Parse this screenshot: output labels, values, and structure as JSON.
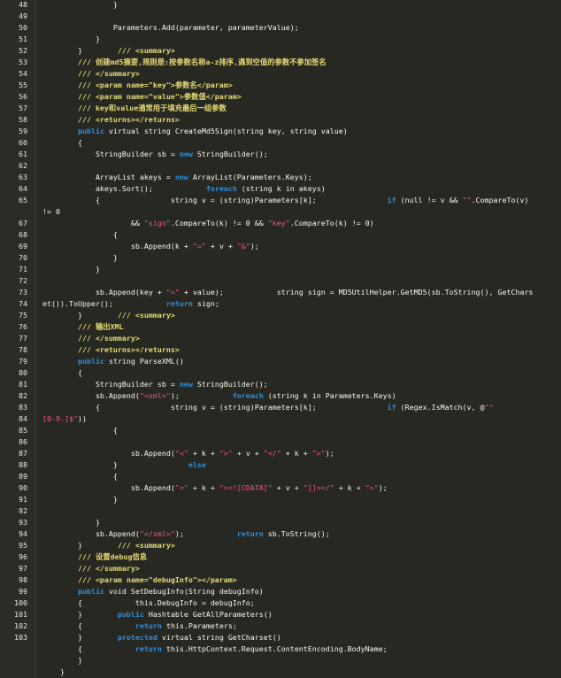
{
  "editor": {
    "colors": {
      "background": "#272822",
      "text": "#f8f8f2",
      "keyword": "#2d8fe0",
      "comment": "#e6db74",
      "string": "#f2558a",
      "line_number": "#e8e8e8"
    },
    "lines": [
      {
        "n": "48",
        "segs": [
          {
            "t": "                }",
            "c": "plain"
          }
        ]
      },
      {
        "n": "49",
        "segs": [
          {
            "t": "",
            "c": "plain"
          }
        ]
      },
      {
        "n": "50",
        "segs": [
          {
            "t": "                Parameters.Add(parameter, parameterValue);",
            "c": "plain"
          }
        ]
      },
      {
        "n": "51",
        "segs": [
          {
            "t": "            }",
            "c": "plain"
          }
        ]
      },
      {
        "n": "52",
        "segs": [
          {
            "t": "        }",
            "c": "plain"
          },
          {
            "t": "        /// <summary>",
            "c": "cm"
          }
        ]
      },
      {
        "n": "53",
        "segs": [
          {
            "t": "        /// 创建md5摘要,规则是:按参数名称a-z排序,遇到空值的参数不参加签名",
            "c": "cm"
          }
        ]
      },
      {
        "n": "54",
        "segs": [
          {
            "t": "        /// </summary>",
            "c": "cm"
          }
        ]
      },
      {
        "n": "55",
        "segs": [
          {
            "t": "        /// <param name=\"key\">参数名</param>",
            "c": "cm"
          }
        ]
      },
      {
        "n": "56",
        "segs": [
          {
            "t": "        /// <param name=\"value\">参数值</param>",
            "c": "cm"
          }
        ]
      },
      {
        "n": "57",
        "segs": [
          {
            "t": "        /// key和value通常用于填充最后一组参数",
            "c": "cm"
          }
        ]
      },
      {
        "n": "58",
        "segs": [
          {
            "t": "        /// <returns></returns>",
            "c": "cm"
          }
        ]
      },
      {
        "n": "59",
        "segs": [
          {
            "t": "        ",
            "c": "plain"
          },
          {
            "t": "public",
            "c": "kw"
          },
          {
            "t": " virtual string CreateMd5Sign(string key, string value)",
            "c": "plain"
          }
        ]
      },
      {
        "n": "60",
        "segs": [
          {
            "t": "        {",
            "c": "plain"
          }
        ]
      },
      {
        "n": "61",
        "segs": [
          {
            "t": "            StringBuilder sb = ",
            "c": "plain"
          },
          {
            "t": "new",
            "c": "kw"
          },
          {
            "t": " StringBuilder();",
            "c": "plain"
          }
        ]
      },
      {
        "n": "62",
        "segs": [
          {
            "t": "",
            "c": "plain"
          }
        ]
      },
      {
        "n": "63",
        "segs": [
          {
            "t": "            ArrayList akeys = ",
            "c": "plain"
          },
          {
            "t": "new",
            "c": "kw"
          },
          {
            "t": " ArrayList(Parameters.Keys);",
            "c": "plain"
          }
        ]
      },
      {
        "n": "64",
        "segs": [
          {
            "t": "            akeys.Sort();            ",
            "c": "plain"
          },
          {
            "t": "foreach",
            "c": "kw"
          },
          {
            "t": " (string k in akeys)",
            "c": "plain"
          }
        ]
      },
      {
        "n": "65",
        "segs": [
          {
            "t": "            {                string v = (string)Parameters[k];                ",
            "c": "plain"
          },
          {
            "t": "if",
            "c": "kw"
          },
          {
            "t": " (null != v && ",
            "c": "plain"
          },
          {
            "t": "\"\"",
            "c": "str"
          },
          {
            "t": ".CompareTo(v)",
            "c": "plain"
          }
        ]
      },
      {
        "n": "",
        "segs": [
          {
            "t": "!= 0",
            "c": "plain"
          }
        ],
        "wrap": true
      },
      {
        "n": "67",
        "segs": [
          {
            "t": "                    && ",
            "c": "plain"
          },
          {
            "t": "\"sign\"",
            "c": "str"
          },
          {
            "t": ".CompareTo(k) != 0 && ",
            "c": "plain"
          },
          {
            "t": "\"key\"",
            "c": "str"
          },
          {
            "t": ".CompareTo(k) != 0)",
            "c": "plain"
          }
        ]
      },
      {
        "n": "68",
        "segs": [
          {
            "t": "                {",
            "c": "plain"
          }
        ]
      },
      {
        "n": "69",
        "segs": [
          {
            "t": "                    sb.Append(k + ",
            "c": "plain"
          },
          {
            "t": "\"=\"",
            "c": "str"
          },
          {
            "t": " + v + ",
            "c": "plain"
          },
          {
            "t": "\"&\"",
            "c": "str"
          },
          {
            "t": ");",
            "c": "plain"
          }
        ]
      },
      {
        "n": "70",
        "segs": [
          {
            "t": "                }",
            "c": "plain"
          }
        ]
      },
      {
        "n": "71",
        "segs": [
          {
            "t": "            }",
            "c": "plain"
          }
        ]
      },
      {
        "n": "72",
        "segs": [
          {
            "t": "",
            "c": "plain"
          }
        ]
      },
      {
        "n": "73",
        "segs": [
          {
            "t": "            sb.Append(key + ",
            "c": "plain"
          },
          {
            "t": "\"=\"",
            "c": "str"
          },
          {
            "t": " + value);            string sign = MD5UtilHelper.GetMD5(sb.ToString(), GetChars",
            "c": "plain"
          }
        ]
      },
      {
        "n": "74",
        "segs": [
          {
            "t": "et()).ToUpper();            ",
            "c": "plain"
          },
          {
            "t": "return",
            "c": "kw"
          },
          {
            "t": " sign;",
            "c": "plain"
          }
        ],
        "wrap": true
      },
      {
        "n": "75",
        "segs": [
          {
            "t": "        }",
            "c": "plain"
          },
          {
            "t": "        /// <summary>",
            "c": "cm"
          }
        ]
      },
      {
        "n": "76",
        "segs": [
          {
            "t": "        /// 输出XML",
            "c": "cm"
          }
        ]
      },
      {
        "n": "77",
        "segs": [
          {
            "t": "        /// </summary>",
            "c": "cm"
          }
        ]
      },
      {
        "n": "78",
        "segs": [
          {
            "t": "        /// <returns></returns>",
            "c": "cm"
          }
        ]
      },
      {
        "n": "79",
        "segs": [
          {
            "t": "        ",
            "c": "plain"
          },
          {
            "t": "public",
            "c": "kw"
          },
          {
            "t": " string ParseXML()",
            "c": "plain"
          }
        ]
      },
      {
        "n": "80",
        "segs": [
          {
            "t": "        {",
            "c": "plain"
          }
        ]
      },
      {
        "n": "81",
        "segs": [
          {
            "t": "            StringBuilder sb = ",
            "c": "plain"
          },
          {
            "t": "new",
            "c": "kw"
          },
          {
            "t": " StringBuilder();",
            "c": "plain"
          }
        ]
      },
      {
        "n": "82",
        "segs": [
          {
            "t": "            sb.Append(",
            "c": "plain"
          },
          {
            "t": "\"<xml>\"",
            "c": "str"
          },
          {
            "t": ");            ",
            "c": "plain"
          },
          {
            "t": "foreach",
            "c": "kw"
          },
          {
            "t": " (string k in Parameters.Keys)",
            "c": "plain"
          }
        ]
      },
      {
        "n": "83",
        "segs": [
          {
            "t": "            {                string v = (string)Parameters[k];                ",
            "c": "plain"
          },
          {
            "t": "if",
            "c": "kw"
          },
          {
            "t": " (Regex.IsMatch(v, @",
            "c": "plain"
          },
          {
            "t": "\"^",
            "c": "str"
          }
        ]
      },
      {
        "n": "84",
        "segs": [
          {
            "t": "[0-9.]$\"",
            "c": "str"
          },
          {
            "t": "))",
            "c": "plain"
          }
        ],
        "wrap": true
      },
      {
        "n": "85",
        "segs": [
          {
            "t": "                {",
            "c": "plain"
          }
        ]
      },
      {
        "n": "86",
        "segs": [
          {
            "t": "",
            "c": "plain"
          }
        ]
      },
      {
        "n": "87",
        "segs": [
          {
            "t": "                    sb.Append(",
            "c": "plain"
          },
          {
            "t": "\"<\"",
            "c": "str"
          },
          {
            "t": " + k + ",
            "c": "plain"
          },
          {
            "t": "\">\"",
            "c": "str"
          },
          {
            "t": " + v + ",
            "c": "plain"
          },
          {
            "t": "\"</\"",
            "c": "str"
          },
          {
            "t": " + k + ",
            "c": "plain"
          },
          {
            "t": "\">\"",
            "c": "str"
          },
          {
            "t": ");",
            "c": "plain"
          }
        ]
      },
      {
        "n": "88",
        "segs": [
          {
            "t": "                }                ",
            "c": "plain"
          },
          {
            "t": "else",
            "c": "kw"
          }
        ]
      },
      {
        "n": "89",
        "segs": [
          {
            "t": "                {",
            "c": "plain"
          }
        ]
      },
      {
        "n": "90",
        "segs": [
          {
            "t": "                    sb.Append(",
            "c": "plain"
          },
          {
            "t": "\"<\"",
            "c": "str"
          },
          {
            "t": " + k + ",
            "c": "plain"
          },
          {
            "t": "\"><![CDATA[\"",
            "c": "str"
          },
          {
            "t": " + v + ",
            "c": "plain"
          },
          {
            "t": "\"]]></\"",
            "c": "str"
          },
          {
            "t": " + k + ",
            "c": "plain"
          },
          {
            "t": "\">\"",
            "c": "str"
          },
          {
            "t": ");",
            "c": "plain"
          }
        ]
      },
      {
        "n": "91",
        "segs": [
          {
            "t": "                }",
            "c": "plain"
          }
        ]
      },
      {
        "n": "92",
        "segs": [
          {
            "t": "",
            "c": "plain"
          }
        ]
      },
      {
        "n": "93",
        "segs": [
          {
            "t": "            }",
            "c": "plain"
          }
        ]
      },
      {
        "n": "94",
        "segs": [
          {
            "t": "            sb.Append(",
            "c": "plain"
          },
          {
            "t": "\"</xml>\"",
            "c": "str"
          },
          {
            "t": ");            ",
            "c": "plain"
          },
          {
            "t": "return",
            "c": "kw"
          },
          {
            "t": " sb.ToString();",
            "c": "plain"
          }
        ]
      },
      {
        "n": "95",
        "segs": [
          {
            "t": "        }",
            "c": "plain"
          },
          {
            "t": "        /// <summary>",
            "c": "cm"
          }
        ]
      },
      {
        "n": "96",
        "segs": [
          {
            "t": "        /// 设置debug信息",
            "c": "cm"
          }
        ]
      },
      {
        "n": "97",
        "segs": [
          {
            "t": "        /// </summary>",
            "c": "cm"
          }
        ]
      },
      {
        "n": "98",
        "segs": [
          {
            "t": "        /// <param name=\"debugInfo\"></param>",
            "c": "cm"
          }
        ]
      },
      {
        "n": "99",
        "segs": [
          {
            "t": "        ",
            "c": "plain"
          },
          {
            "t": "public",
            "c": "kw"
          },
          {
            "t": " void SetDebugInfo(String debugInfo)",
            "c": "plain"
          }
        ]
      },
      {
        "n": "100",
        "segs": [
          {
            "t": "        {            this.DebugInfo = debugInfo;",
            "c": "plain"
          }
        ]
      },
      {
        "n": "101",
        "segs": [
          {
            "t": "        }        ",
            "c": "plain"
          },
          {
            "t": "public",
            "c": "kw"
          },
          {
            "t": " Hashtable GetAllParameters()",
            "c": "plain"
          }
        ]
      },
      {
        "n": "102",
        "segs": [
          {
            "t": "        {            ",
            "c": "plain"
          },
          {
            "t": "return",
            "c": "kw"
          },
          {
            "t": " this.Parameters;",
            "c": "plain"
          }
        ]
      },
      {
        "n": "103",
        "segs": [
          {
            "t": "        }        ",
            "c": "plain"
          },
          {
            "t": "protected",
            "c": "kw"
          },
          {
            "t": " virtual string GetCharset()",
            "c": "plain"
          }
        ]
      },
      {
        "n": "",
        "segs": [
          {
            "t": "        {            ",
            "c": "plain"
          },
          {
            "t": "return",
            "c": "kw"
          },
          {
            "t": " this.HttpContext.Request.ContentEncoding.BodyName;",
            "c": "plain"
          }
        ]
      },
      {
        "n": "",
        "segs": [
          {
            "t": "        }",
            "c": "plain"
          }
        ]
      },
      {
        "n": "",
        "segs": [
          {
            "t": "    }",
            "c": "plain"
          }
        ]
      }
    ]
  }
}
